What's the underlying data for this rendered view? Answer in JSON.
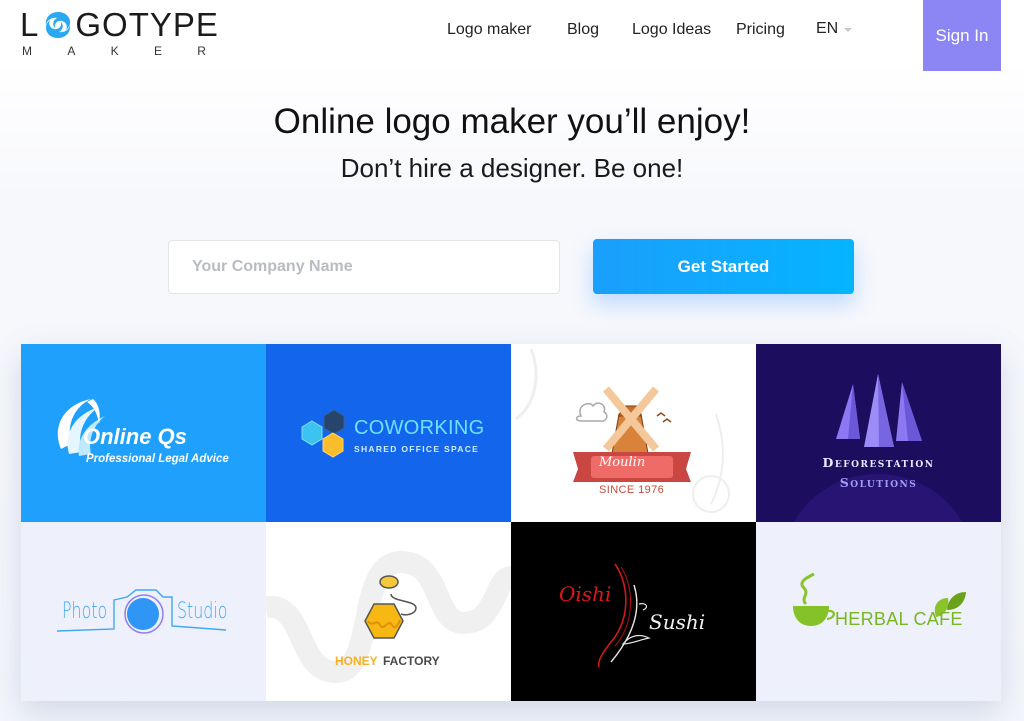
{
  "header": {
    "logo": {
      "word": "LOGOTYPE",
      "word_first": "L",
      "word_rest": "GOTYPE",
      "sub_letters": [
        "M",
        "A",
        "K",
        "E",
        "R"
      ],
      "alt": "Logotype Maker"
    },
    "nav": [
      {
        "label": "Logo maker"
      },
      {
        "label": "Blog"
      },
      {
        "label": "Logo Ideas"
      },
      {
        "label": "Pricing"
      }
    ],
    "language": {
      "selected": "EN"
    },
    "sign_in_label": "Sign In",
    "sign_in_color": "#8b86f4"
  },
  "hero": {
    "title": "Online logo maker you’ll enjoy!",
    "subtitle": "Don’t hire a designer. Be one!",
    "company_input": {
      "value": "",
      "placeholder": "Your Company Name"
    },
    "cta_label": "Get Started",
    "cta_color": "#1a9ffc"
  },
  "gallery": {
    "cards": [
      {
        "name": "Online Qs",
        "title": "Online Qs",
        "subtitle": "Professional Legal Advice",
        "background": "#1ea0fc"
      },
      {
        "name": "Coworking",
        "title": "COWORKING",
        "subtitle": "SHARED OFFICE SPACE",
        "background": "#1366ec"
      },
      {
        "name": "Moulin",
        "title": "Moulin",
        "subtitle": "SINCE 1976",
        "background": "#ffffff"
      },
      {
        "name": "Deforestation Solutions",
        "title": "Deforestation",
        "subtitle": "Solutions",
        "background": "#1c0d5e"
      },
      {
        "name": "Photo Studio",
        "title": "Photo",
        "subtitle": "Studio",
        "background": "#eef1fb"
      },
      {
        "name": "Honey Factory",
        "title": "HONEY",
        "subtitle": "FACTORY",
        "background": "#ffffff"
      },
      {
        "name": "Oishi Sushi",
        "title": "Oishi",
        "subtitle": "Sushi",
        "background": "#000000"
      },
      {
        "name": "Herbal Cafe",
        "title": "HERBAL CAFE",
        "subtitle": "",
        "background": "#eef1fb"
      }
    ]
  }
}
